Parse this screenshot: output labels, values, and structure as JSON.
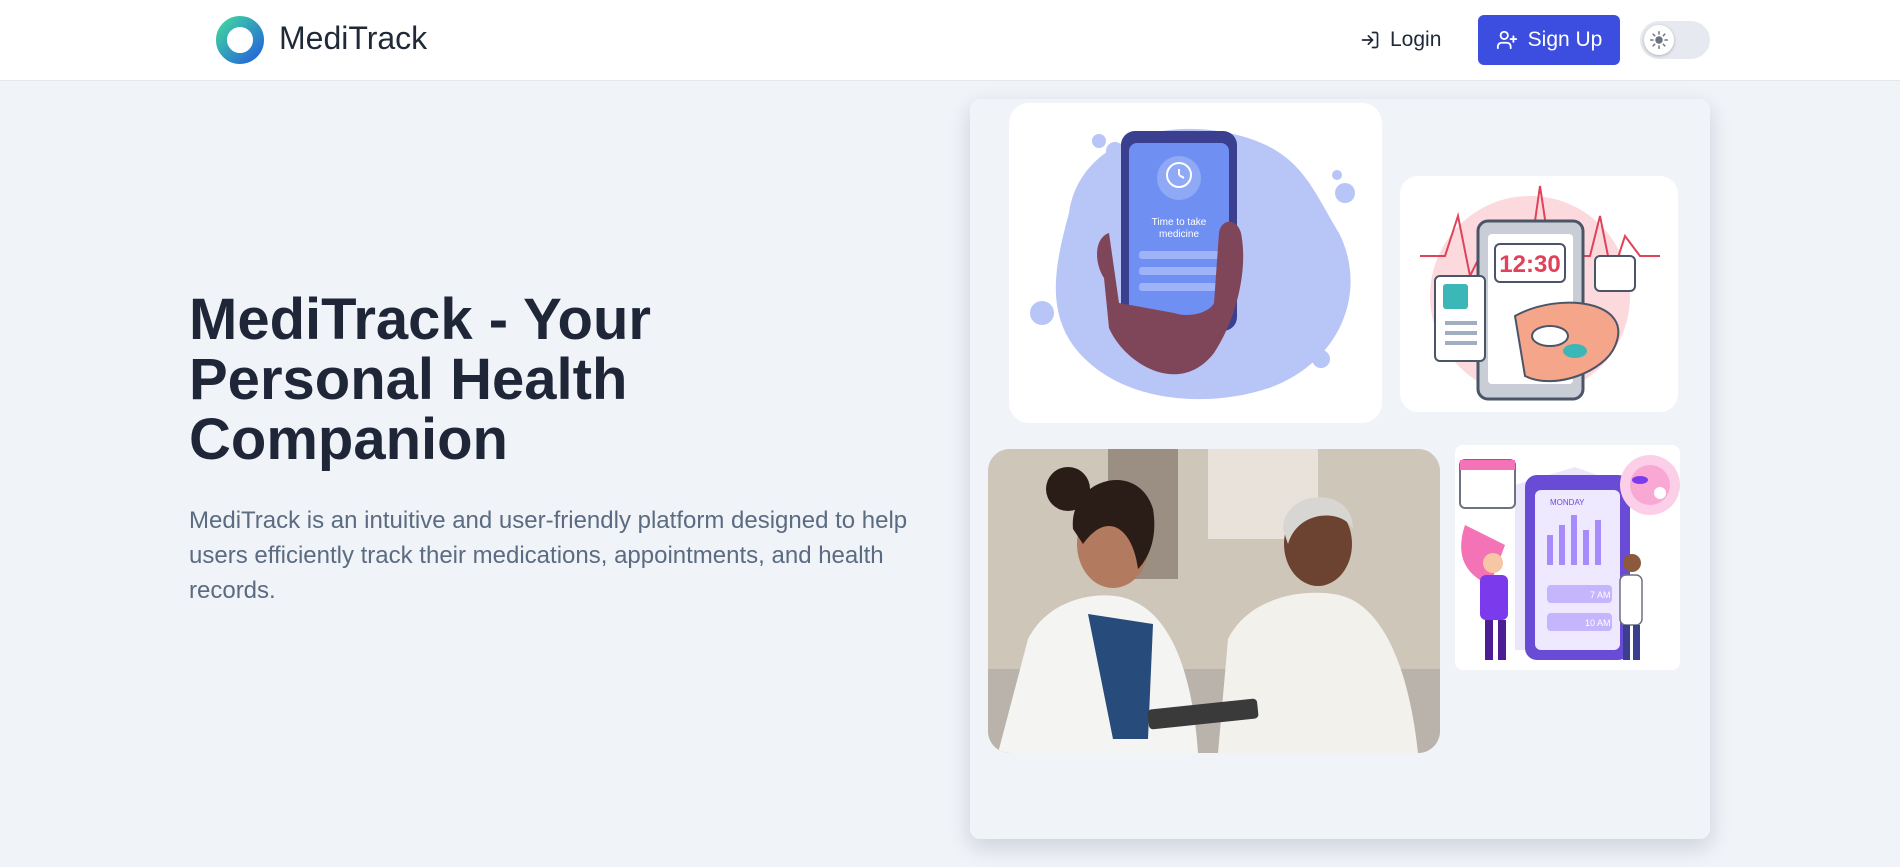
{
  "header": {
    "brand": "MediTrack",
    "login_label": "Login",
    "signup_label": "Sign Up",
    "theme_toggle": "light"
  },
  "hero": {
    "title": "MediTrack - Your Personal Health Companion",
    "description": "MediTrack is an intuitive and user-friendly platform designed to help users efficiently track their medications, appointments, and health records."
  },
  "illustrations": {
    "phone_reminder": {
      "line1": "Time to take",
      "line2": "medicine"
    },
    "clock": {
      "time": "12:30"
    },
    "schedule": {
      "day": "MONDAY",
      "slot1": "7 AM",
      "slot2": "10 AM"
    }
  },
  "colors": {
    "accent": "#3b4ee0",
    "title": "#1e2638",
    "text_muted": "#5b6b81",
    "background": "#f0f3f8",
    "logo_teal": "#34c9a8",
    "logo_blue": "#2b7bd8"
  },
  "icons": [
    "logo-ring-icon",
    "login-icon",
    "user-plus-icon",
    "sun-icon"
  ]
}
